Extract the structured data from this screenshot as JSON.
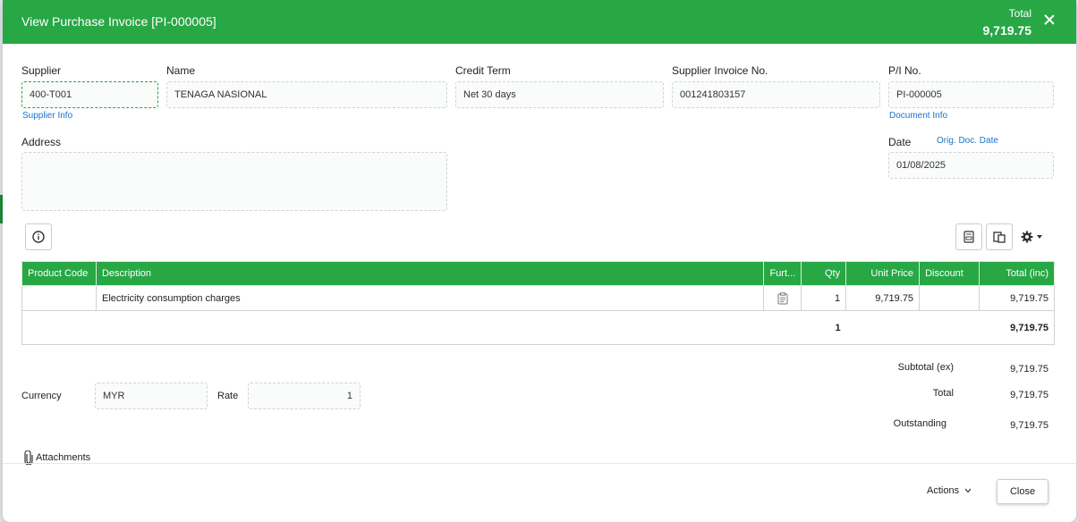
{
  "header": {
    "title": "View Purchase Invoice [PI-000005]",
    "total_label": "Total",
    "total_value": "9,719.75"
  },
  "form": {
    "supplier": {
      "label": "Supplier",
      "value": "400-T001",
      "link": "Supplier Info"
    },
    "name": {
      "label": "Name",
      "value": "TENAGA NASIONAL"
    },
    "credit_term": {
      "label": "Credit Term",
      "value": "Net 30 days"
    },
    "supplier_invoice_no": {
      "label": "Supplier Invoice No.",
      "value": "001241803157"
    },
    "pi_no": {
      "label": "P/I No.",
      "value": "PI-000005",
      "link": "Document Info"
    },
    "address": {
      "label": "Address",
      "value": ""
    },
    "date": {
      "label": "Date",
      "value": "01/08/2025",
      "link": "Orig. Doc. Date"
    }
  },
  "table": {
    "headers": [
      "Product Code",
      "Description",
      "Furt...",
      "Qty",
      "Unit Price",
      "Discount",
      "Total (inc)"
    ],
    "rows": [
      {
        "product_code": "",
        "description": "Electricity consumption charges",
        "further_icon": "clipboard-icon",
        "qty": "1",
        "unit_price": "9,719.75",
        "discount": "",
        "total": "9,719.75"
      }
    ],
    "summary": {
      "qty": "1",
      "total": "9,719.75"
    }
  },
  "currency": {
    "label": "Currency",
    "value": "MYR",
    "rate_label": "Rate",
    "rate_value": "1"
  },
  "totals": {
    "subtotal_label": "Subtotal (ex)",
    "subtotal_value": "9,719.75",
    "total_label": "Total",
    "total_value": "9,719.75",
    "outstanding_label": "Outstanding",
    "outstanding_value": "9,719.75"
  },
  "attachments_label": "Attachments",
  "footer": {
    "actions_label": "Actions",
    "close_label": "Close"
  },
  "colors": {
    "accent": "#28a745",
    "link": "#1a73c9"
  }
}
